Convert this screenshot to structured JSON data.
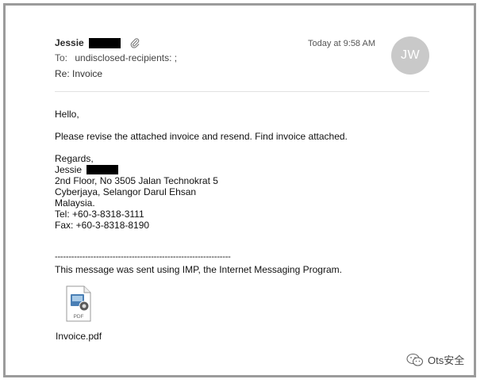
{
  "header": {
    "sender_name": "Jessie",
    "time": "Today at 9:58 AM",
    "avatar_initials": "JW",
    "to_label": "To:",
    "to_value": "undisclosed-recipients: ;",
    "subject": "Re: Invoice"
  },
  "body": {
    "greeting": "Hello,",
    "message": "Please revise the attached invoice and resend. Find invoice attached.",
    "regards": "Regards,",
    "signature_name": "Jessie",
    "address_1": "2nd Floor, No 3505 Jalan Technokrat 5",
    "address_2": "Cyberjaya, Selangor Darul Ehsan",
    "address_3": "Malaysia.",
    "tel": "Tel: +60-3-8318-3111",
    "fax": "Fax: +60-3-8318-8190",
    "separator": "----------------------------------------------------------------",
    "footer": "This message was sent using IMP, the Internet Messaging Program."
  },
  "attachment": {
    "icon": "pdf-file-icon",
    "icon_label": "PDF",
    "filename": "Invoice.pdf"
  },
  "watermark": {
    "icon": "wechat-icon",
    "text": "Ots安全"
  },
  "colors": {
    "avatar_bg": "#c9c9c9",
    "frame_border": "#9b9b9b",
    "redaction": "#000000"
  }
}
